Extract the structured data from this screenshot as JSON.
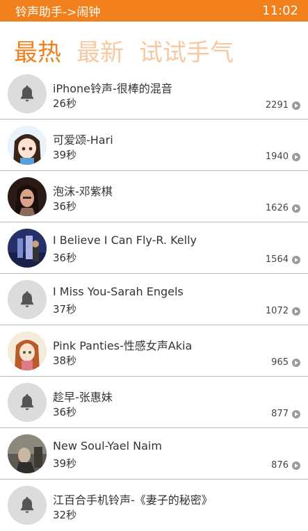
{
  "status_bar": {
    "title": "铃声助手->闹钟",
    "time": "11:02"
  },
  "pivot": {
    "tabs": [
      "最热",
      "最新",
      "试试手气"
    ],
    "active_index": 0
  },
  "ringtones": [
    {
      "title": "iPhone铃声-很棒的混音",
      "duration": "26秒",
      "count": "2291",
      "avatar": "bell"
    },
    {
      "title": "可爱颂-Hari",
      "duration": "39秒",
      "count": "1940",
      "avatar": "anime-girl"
    },
    {
      "title": "泡沫-邓紫棋",
      "duration": "36秒",
      "count": "1626",
      "avatar": "singer-photo"
    },
    {
      "title": "I Believe I Can Fly-R. Kelly",
      "duration": "36秒",
      "count": "1564",
      "avatar": "album-art"
    },
    {
      "title": "I Miss You-Sarah Engels",
      "duration": "37秒",
      "count": "1072",
      "avatar": "bell"
    },
    {
      "title": "Pink Panties-性感女声Akia",
      "duration": "38秒",
      "count": "965",
      "avatar": "anime-girl-2"
    },
    {
      "title": "趁早-张惠妹",
      "duration": "36秒",
      "count": "877",
      "avatar": "bell"
    },
    {
      "title": "New Soul-Yael Naim",
      "duration": "39秒",
      "count": "876",
      "avatar": "photo-dark"
    },
    {
      "title": "江百合手机铃声-《妻子的秘密》",
      "duration": "32秒",
      "count": "",
      "avatar": "bell"
    }
  ]
}
